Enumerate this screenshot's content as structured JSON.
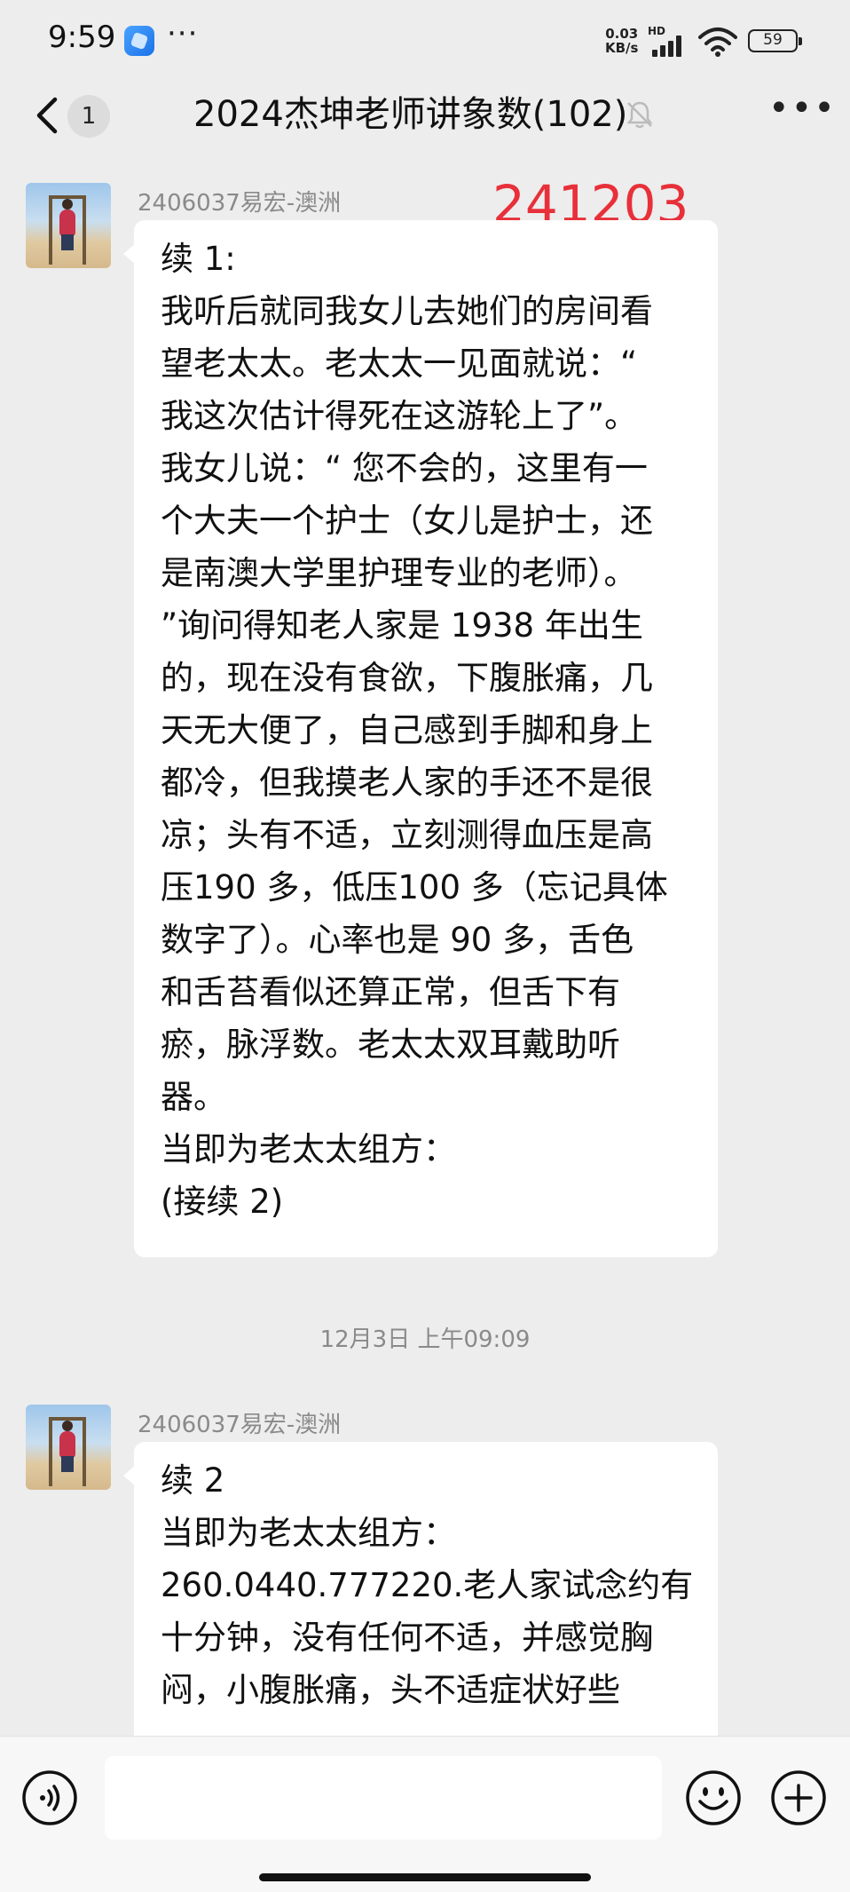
{
  "status_bar": {
    "time": "9:59",
    "more": "···",
    "net_speed": "0.03",
    "net_unit": "KB/s",
    "hd": "HD",
    "battery": "59"
  },
  "nav": {
    "unread_count": "1",
    "title": "2024杰坤老师讲象数(102)"
  },
  "messages": [
    {
      "sender": "2406037易宏-澳洲",
      "overlay": "241203",
      "lines": [
        "续 1:",
        "我听后就同我女儿去她们的房间看",
        "望老太太。老太太一见面就说：“",
        "我这次估计得死在这游轮上了”。",
        "我女儿说：“ 您不会的，这里有一",
        "个大夫一个护士（女儿是护士，还",
        "是南澳大学里护理专业的老师）。",
        "”询问得知老人家是 1938 年出生",
        "的，现在没有食欲，下腹胀痛，几",
        "天无大便了，自己感到手脚和身上",
        "都冷，但我摸老人家的手还不是很",
        "凉；头有不适，立刻测得血压是高",
        "压190 多，低压100 多（忘记具体",
        "数字了）。心率也是 90 多，舌色",
        "和舌苔看似还算正常，但舌下有",
        "瘀，脉浮数。老太太双耳戴助听",
        "器。",
        "当即为老太太组方：",
        "(接续 2)"
      ]
    },
    {
      "sender": "2406037易宏-澳洲",
      "lines": [
        "续 2",
        "当即为老太太组方：",
        "260.0440.777220.老人家试念约有",
        "十分钟，没有任何不适，并感觉胸",
        "闷，小腹胀痛，头不适症状好些"
      ]
    }
  ],
  "timestamp": "12月3日 上午09:09",
  "input": {
    "placeholder": ""
  }
}
